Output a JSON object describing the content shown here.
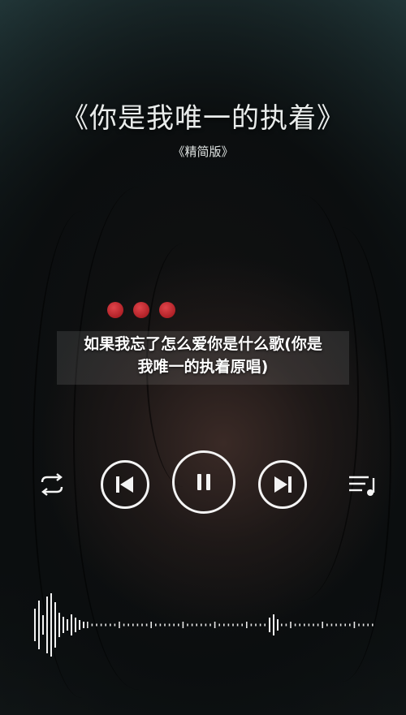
{
  "song": {
    "title": "《你是我唯一的执着》",
    "edition": "《精简版》"
  },
  "caption": {
    "line1": "如果我忘了怎么爱你是什么歌(你是",
    "line2": "我唯一的执着原唱)"
  },
  "player": {
    "icons": {
      "repeat": "repeat-icon",
      "previous": "skip-previous-icon",
      "pause": "pause-icon",
      "next": "skip-next-icon",
      "playlist": "playlist-icon"
    },
    "accent_color": "#f4f4f4"
  },
  "page_dots": {
    "count": 3,
    "color": "#c8242b"
  }
}
